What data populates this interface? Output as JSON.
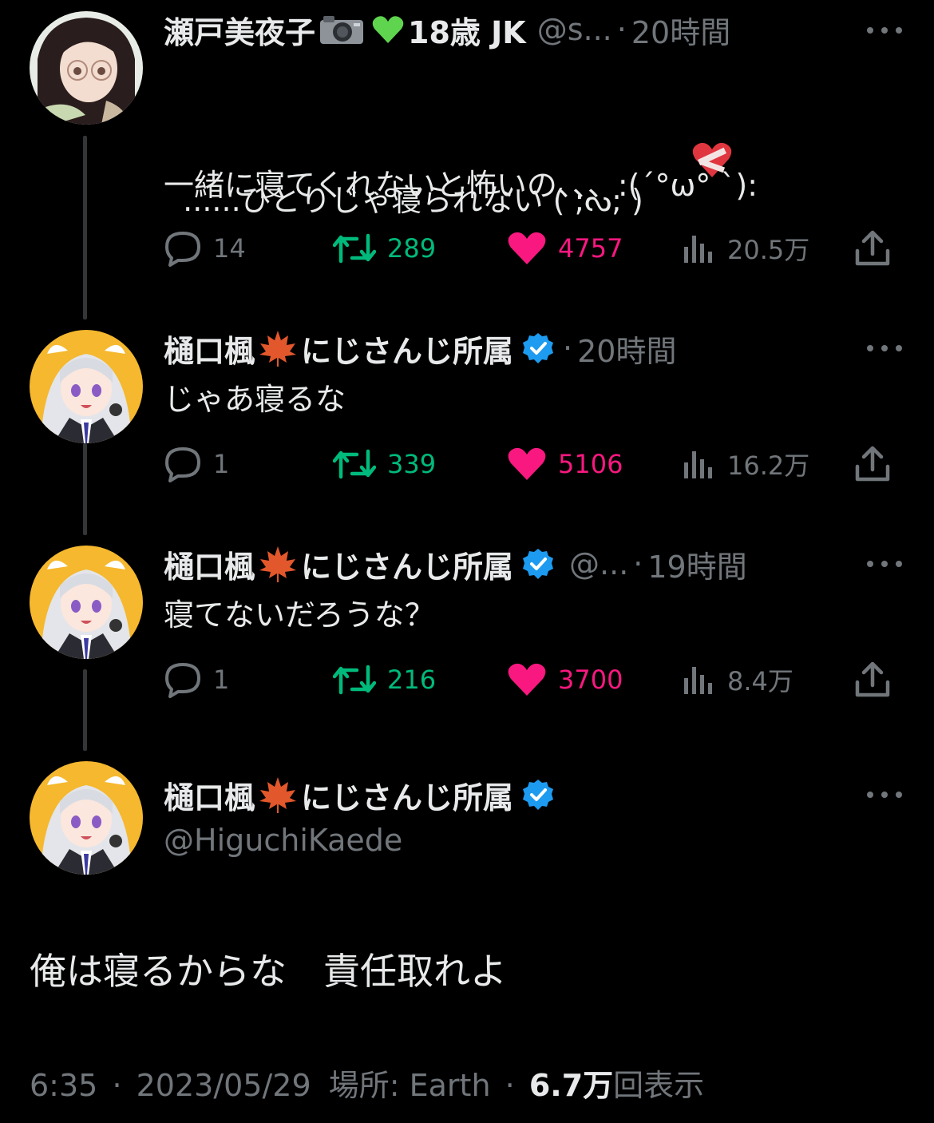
{
  "colors": {
    "background": "#000000",
    "text": "#e7e9ea",
    "muted": "#71767b",
    "retweet": "#00ba7c",
    "like": "#f91880",
    "verified": "#1d9bf0"
  },
  "tweets": [
    {
      "name": "瀬戸美夜子",
      "name_suffix": "18歳 JK",
      "handle": "@s...",
      "time": "20時間",
      "text": "......ひとりじゃ寝られない ( ;ᔓ; ) ",
      "text2": "一緒に寝てくれないと怖いの、、、:(´°ω° `):",
      "stats": {
        "replies": "14",
        "retweets": "289",
        "likes": "4757",
        "views": "20.5万"
      }
    },
    {
      "name": "樋口楓",
      "name_suffix": "にじさんじ所属",
      "handle": "",
      "time": "20時間",
      "text": "じゃあ寝るな",
      "stats": {
        "replies": "1",
        "retweets": "339",
        "likes": "5106",
        "views": "16.2万"
      }
    },
    {
      "name": "樋口楓",
      "name_suffix": "にじさんじ所属",
      "handle": "@...",
      "time": "19時間",
      "text": "寝てないだろうな？",
      "stats": {
        "replies": "1",
        "retweets": "216",
        "likes": "3700",
        "views": "8.4万"
      }
    }
  ],
  "main": {
    "name": "樋口楓",
    "name_suffix": "にじさんじ所属",
    "handle": "@HiguchiKaede",
    "text": "俺は寝るからな　責任取れよ",
    "time": "6:35",
    "date": "2023/05/29",
    "location": "場所: Earth",
    "views_count": "6.7万",
    "views_label": "回表示"
  }
}
